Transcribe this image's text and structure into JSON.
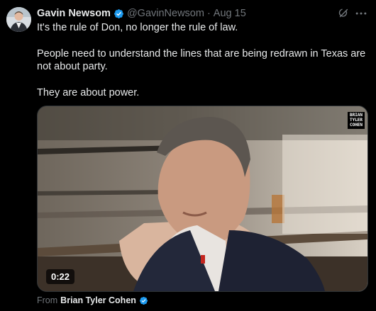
{
  "post": {
    "author_name": "Gavin Newsom",
    "author_handle": "@GavinNewsom",
    "separator": "·",
    "date": "Aug 15",
    "paragraphs": [
      "It's the rule of Don, no longer the rule of law.",
      "People need to understand the lines that are being redrawn in Texas are not about party.",
      "They are about power."
    ]
  },
  "media": {
    "duration": "0:22",
    "watermark_lines": [
      "BRIAN",
      "TYLER",
      "COHEN"
    ]
  },
  "attribution": {
    "prefix": "From",
    "source_name": "Brian Tyler Cohen"
  },
  "icons": {
    "verified": "verified-badge-icon",
    "grok": "grok-icon",
    "more": "more-options-icon"
  },
  "colors": {
    "background": "#000000",
    "text_primary": "#e7e9ea",
    "text_secondary": "#71767b",
    "verified_blue": "#1d9bf0"
  }
}
